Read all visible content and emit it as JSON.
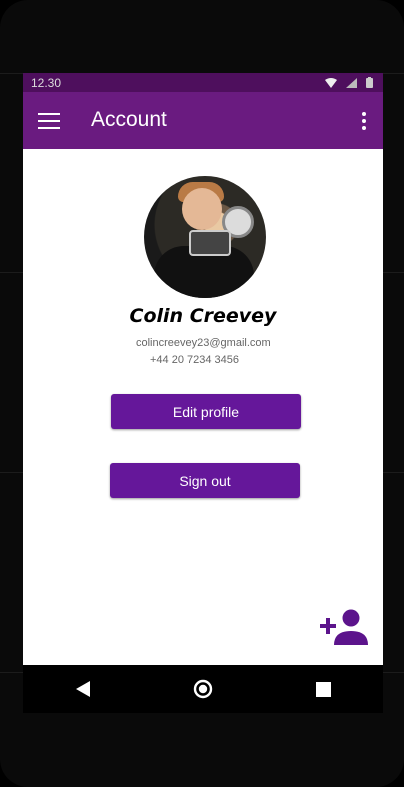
{
  "status_bar": {
    "time": "12.30"
  },
  "app_bar": {
    "title": "Account"
  },
  "profile": {
    "name": "Colin Creevey",
    "email": "colincreevey23@gmail.com",
    "phone": "+44 20 7234 3456"
  },
  "actions": {
    "edit_profile": "Edit profile",
    "sign_out": "Sign out"
  },
  "icons": {
    "menu": "menu-icon",
    "more": "more-vert-icon",
    "add_person": "person-add-icon",
    "back": "back-icon",
    "home": "home-icon",
    "recents": "recents-icon"
  },
  "colors": {
    "app_bar": "#6a1b80",
    "status_bar": "#4e0f5d",
    "button": "#65179a",
    "fab_icon": "#5c148c"
  }
}
